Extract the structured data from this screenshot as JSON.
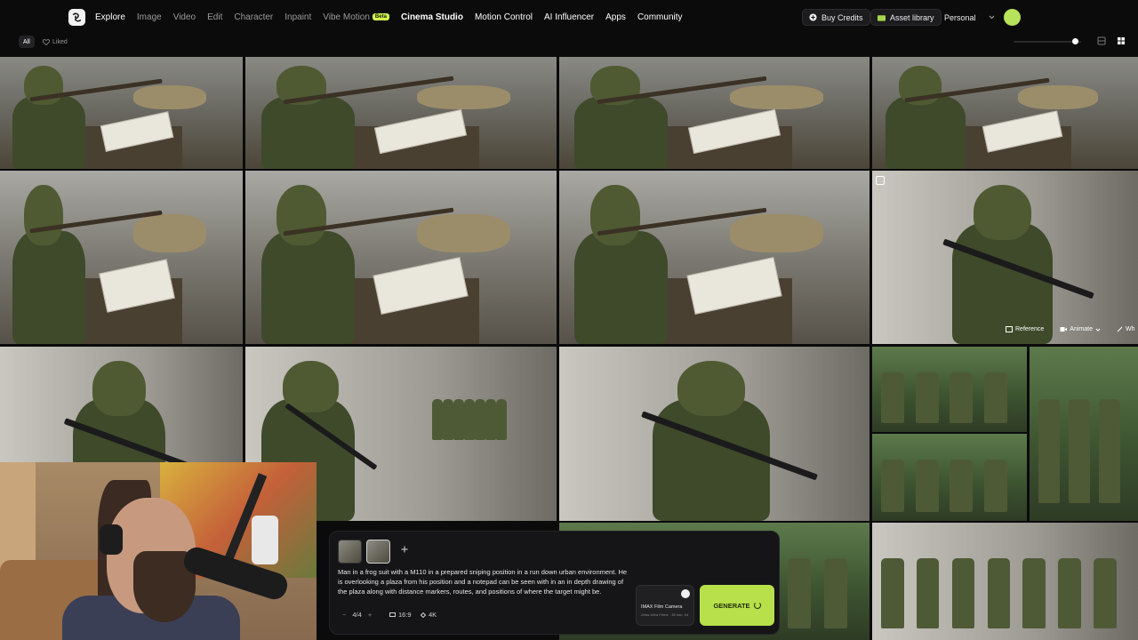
{
  "nav": {
    "items": [
      {
        "label": "Explore",
        "state": "active"
      },
      {
        "label": "Image",
        "state": ""
      },
      {
        "label": "Video",
        "state": ""
      },
      {
        "label": "Edit",
        "state": ""
      },
      {
        "label": "Character",
        "state": ""
      },
      {
        "label": "Inpaint",
        "state": ""
      },
      {
        "label": "Vibe Motion",
        "state": "",
        "badge": "Beta"
      },
      {
        "label": "Cinema Studio",
        "state": "bold"
      },
      {
        "label": "Motion Control",
        "state": "active"
      },
      {
        "label": "AI Influencer",
        "state": "active"
      },
      {
        "label": "Apps",
        "state": "active"
      },
      {
        "label": "Community",
        "state": "active"
      }
    ],
    "buy_credits": "Buy Credits",
    "asset_library": "Asset library",
    "workspace": "Personal"
  },
  "filters": {
    "all": "All",
    "liked": "Liked"
  },
  "tile_actions": {
    "reference": "Reference",
    "animate": "Animate",
    "more": "Wh"
  },
  "prompt": {
    "text": "Man in a frog suit with a M110 in a prepared sniping position in a run down urban environment. He is overlooking a plaza from his position and a notepad can be seen with in an in depth drawing of the plaza along with distance markers, routes, and positions of where the target might be.",
    "count": "4/4",
    "aspect": "16:9",
    "resolution": "4K",
    "camera_title": "IMAX Film Camera",
    "camera_sub": "Zeiss Ultra Prime · 35 mm, f/4",
    "generate": "GENERATE"
  },
  "colors": {
    "accent": "#b8e04a",
    "background": "#0b0b0c",
    "panel": "#151517"
  }
}
